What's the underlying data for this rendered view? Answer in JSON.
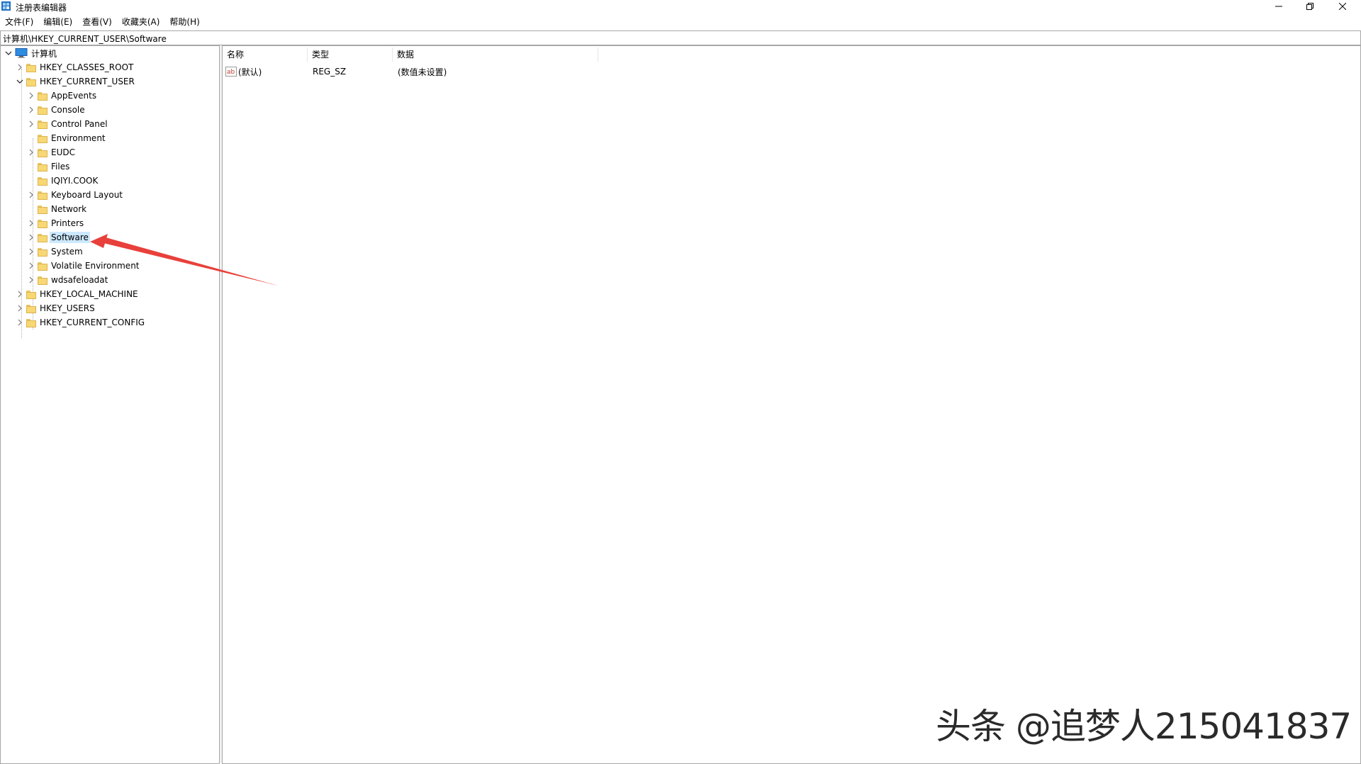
{
  "window": {
    "title": "注册表编辑器",
    "controls": {
      "minimize": "minimize-icon",
      "restore": "restore-icon",
      "close": "close-icon"
    }
  },
  "menu": {
    "items": [
      "文件(F)",
      "编辑(E)",
      "查看(V)",
      "收藏夹(A)",
      "帮助(H)"
    ]
  },
  "address": {
    "path": "计算机\\HKEY_CURRENT_USER\\Software"
  },
  "tree": {
    "root": "计算机",
    "nodes": [
      {
        "label": "HKEY_CLASSES_ROOT"
      },
      {
        "label": "HKEY_CURRENT_USER"
      },
      {
        "label": "AppEvents"
      },
      {
        "label": "Console"
      },
      {
        "label": "Control Panel"
      },
      {
        "label": "Environment"
      },
      {
        "label": "EUDC"
      },
      {
        "label": "Files"
      },
      {
        "label": "IQIYI.COOK"
      },
      {
        "label": "Keyboard Layout"
      },
      {
        "label": "Network"
      },
      {
        "label": "Printers"
      },
      {
        "label": "Software",
        "selected": true
      },
      {
        "label": "System"
      },
      {
        "label": "Volatile Environment"
      },
      {
        "label": "wdsafeloadat"
      },
      {
        "label": "HKEY_LOCAL_MACHINE"
      },
      {
        "label": "HKEY_USERS"
      },
      {
        "label": "HKEY_CURRENT_CONFIG"
      }
    ]
  },
  "list": {
    "columns": [
      "名称",
      "类型",
      "数据"
    ],
    "rows": [
      {
        "name": "(默认)",
        "type": "REG_SZ",
        "data": "(数值未设置)",
        "icon": "string-value-icon"
      }
    ]
  },
  "annotation": {
    "arrow_color": "#e8403a"
  },
  "watermark": {
    "text": "头条 @追梦人215041837"
  }
}
